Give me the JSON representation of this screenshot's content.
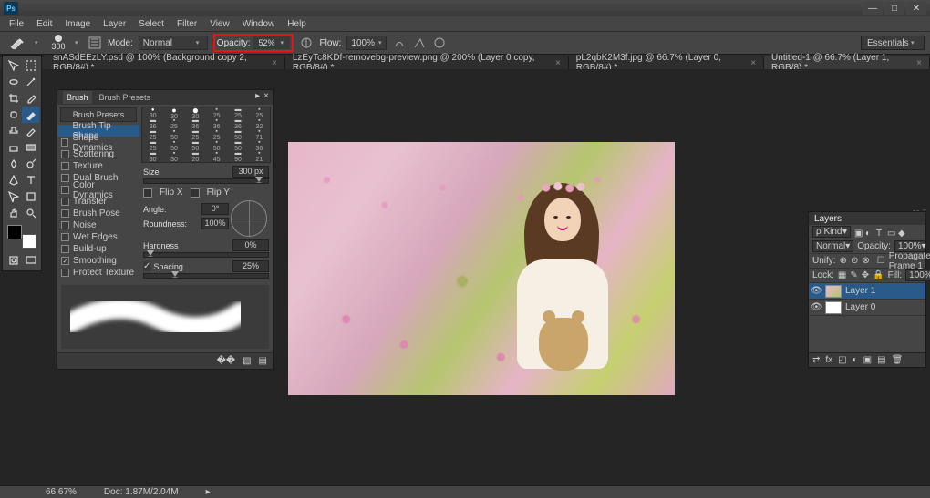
{
  "app": {
    "badge": "Ps"
  },
  "menus": [
    "File",
    "Edit",
    "Image",
    "Layer",
    "Select",
    "Filter",
    "View",
    "Window",
    "Help"
  ],
  "options": {
    "brush_size": "300",
    "mode_label": "Mode:",
    "mode_value": "Normal",
    "opacity_label": "Opacity:",
    "opacity_value": "52%",
    "flow_label": "Flow:",
    "flow_value": "100%",
    "workspace": "Essentials"
  },
  "doc_tabs": [
    {
      "label": "snASdEEzLY.psd @ 100% (Background copy 2, RGB/8#) *",
      "active": false
    },
    {
      "label": "LzEyTc8KDf-removebg-preview.png @ 200% (Layer 0 copy, RGB/8#) *",
      "active": false
    },
    {
      "label": "pL2qbK2M3f.jpg @ 66.7% (Layer 0, RGB/8#) *",
      "active": false
    },
    {
      "label": "Untitled-1 @ 66.7% (Layer 1, RGB/8) *",
      "active": true
    }
  ],
  "brush_panel": {
    "tabs": [
      "Brush",
      "Brush Presets"
    ],
    "presets_btn": "Brush Presets",
    "options": [
      {
        "label": "Brush Tip Shape",
        "cb": null,
        "sel": true
      },
      {
        "label": "Shape Dynamics",
        "cb": false
      },
      {
        "label": "Scattering",
        "cb": false
      },
      {
        "label": "Texture",
        "cb": false
      },
      {
        "label": "Dual Brush",
        "cb": false
      },
      {
        "label": "Color Dynamics",
        "cb": false
      },
      {
        "label": "Transfer",
        "cb": false
      },
      {
        "label": "Brush Pose",
        "cb": false
      },
      {
        "label": "Noise",
        "cb": false
      },
      {
        "label": "Wet Edges",
        "cb": false
      },
      {
        "label": "Build-up",
        "cb": false
      },
      {
        "label": "Smoothing",
        "cb": true
      },
      {
        "label": "Protect Texture",
        "cb": false
      }
    ],
    "tip_sizes_rows": [
      [
        "30",
        "30",
        "30",
        "25",
        "25",
        "25"
      ],
      [
        "36",
        "25",
        "36",
        "36",
        "36",
        "32"
      ],
      [
        "25",
        "50",
        "25",
        "25",
        "50",
        "71"
      ],
      [
        "25",
        "50",
        "50",
        "50",
        "50",
        "36"
      ],
      [
        "30",
        "30",
        "20",
        "45",
        "90",
        "21"
      ]
    ],
    "size_label": "Size",
    "size_value": "300 px",
    "flipx": "Flip X",
    "flipy": "Flip Y",
    "angle_label": "Angle:",
    "angle_value": "0°",
    "round_label": "Roundness:",
    "round_value": "100%",
    "hard_label": "Hardness",
    "hard_value": "0%",
    "spacing_label": "Spacing",
    "spacing_value": "25%"
  },
  "layers_panel": {
    "tab": "Layers",
    "kind": "ρ Kind",
    "blend": "Normal",
    "opacity_label": "Opacity:",
    "opacity": "100%",
    "unify": "Unify:",
    "propagate": "Propagate Frame 1",
    "lock_label": "Lock:",
    "fill_label": "Fill:",
    "fill": "100%",
    "layers": [
      {
        "name": "Layer 1",
        "sel": true,
        "thumb": "photo"
      },
      {
        "name": "Layer 0",
        "sel": false,
        "thumb": "white"
      }
    ]
  },
  "status": {
    "zoom": "66.67%",
    "doc": "Doc: 1.87M/2.04M"
  }
}
